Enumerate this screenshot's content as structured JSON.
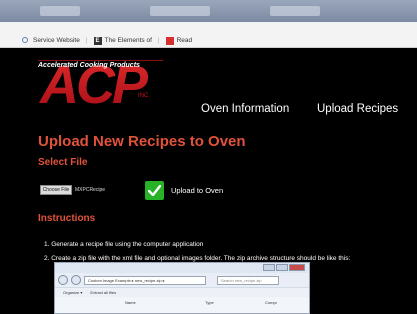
{
  "bookmarks": [
    {
      "label": "Service Website",
      "icon": "search-icon"
    },
    {
      "label": "The Elements of",
      "icon": "book-icon"
    },
    {
      "label": "Read",
      "icon": "read-icon"
    }
  ],
  "header": {
    "logo_text": "ACP",
    "logo_suffix": "INC.",
    "tagline": "Accelerated Cooking Products",
    "nav": {
      "oven_info": "Oven Information",
      "upload_recipes": "Upload Recipes"
    }
  },
  "main": {
    "title": "Upload New Recipes to Oven",
    "select_file_heading": "Select File",
    "file_button": "Choose File",
    "file_name": "MXPCRecipe",
    "upload_label": "Upload to Oven",
    "instructions_heading": "Instructions",
    "steps": [
      "1.  Generate a recipe file using the computer application",
      "2.  Create a zip file with the xml file and optional images folder. The zip archive structure should be like this:"
    ]
  },
  "explorer": {
    "path": "Custom Image Example ▸ new_recipe.zip ▸",
    "search_placeholder": "Search new_recipe.zip",
    "organize": "Organize ▾",
    "extract": "Extract all files",
    "columns": [
      "Name",
      "Type",
      "Compr"
    ]
  },
  "colors": {
    "accent": "#e0533a",
    "logo_red": "#c1121f",
    "success": "#28b228"
  }
}
